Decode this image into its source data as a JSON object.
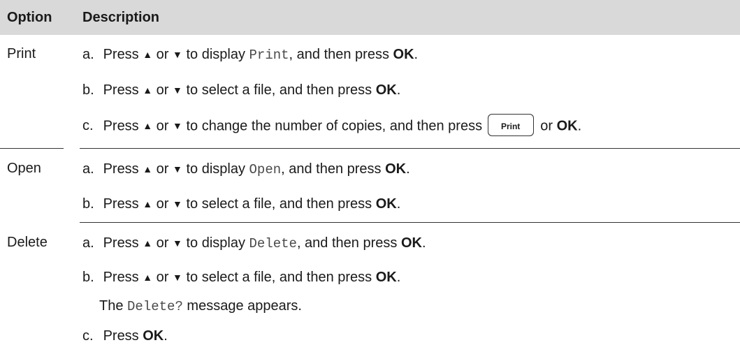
{
  "table": {
    "header": {
      "option": "Option",
      "description": "Description"
    },
    "arrows": {
      "up": "▲",
      "down": "▼"
    },
    "rows": [
      {
        "option": "Print",
        "steps": [
          {
            "marker": "a.",
            "pre": "Press",
            "or": "or",
            "mid": "to display",
            "code": "Print",
            "post": ", and then press",
            "ok": "OK",
            "end": "."
          },
          {
            "marker": "b.",
            "pre": "Press",
            "or": "or",
            "mid": "to select a file, and then press",
            "ok": "OK",
            "end": "."
          },
          {
            "marker": "c.",
            "pre": "Press",
            "or": "or",
            "mid": "to change the number of copies, and then press",
            "key": "Print",
            "post": "or",
            "ok": "OK",
            "end": "."
          }
        ]
      },
      {
        "option": "Open",
        "steps": [
          {
            "marker": "a.",
            "pre": "Press",
            "or": "or",
            "mid": "to display",
            "code": "Open",
            "post": ", and then press",
            "ok": "OK",
            "end": "."
          },
          {
            "marker": "b.",
            "pre": "Press",
            "or": "or",
            "mid": "to select a file, and then press",
            "ok": "OK",
            "end": "."
          }
        ]
      },
      {
        "option": "Delete",
        "steps": [
          {
            "marker": "a.",
            "pre": "Press",
            "or": "or",
            "mid": "to display",
            "code": "Delete",
            "post": ", and then press",
            "ok": "OK",
            "end": "."
          },
          {
            "marker": "b.",
            "pre": "Press",
            "or": "or",
            "mid": "to select a file, and then press",
            "ok": "OK",
            "end": "."
          },
          {
            "note_pre": "The",
            "note_code": "Delete?",
            "note_post": "message appears."
          },
          {
            "marker": "c.",
            "pre": "Press",
            "ok": "OK",
            "end": "."
          }
        ]
      }
    ]
  }
}
